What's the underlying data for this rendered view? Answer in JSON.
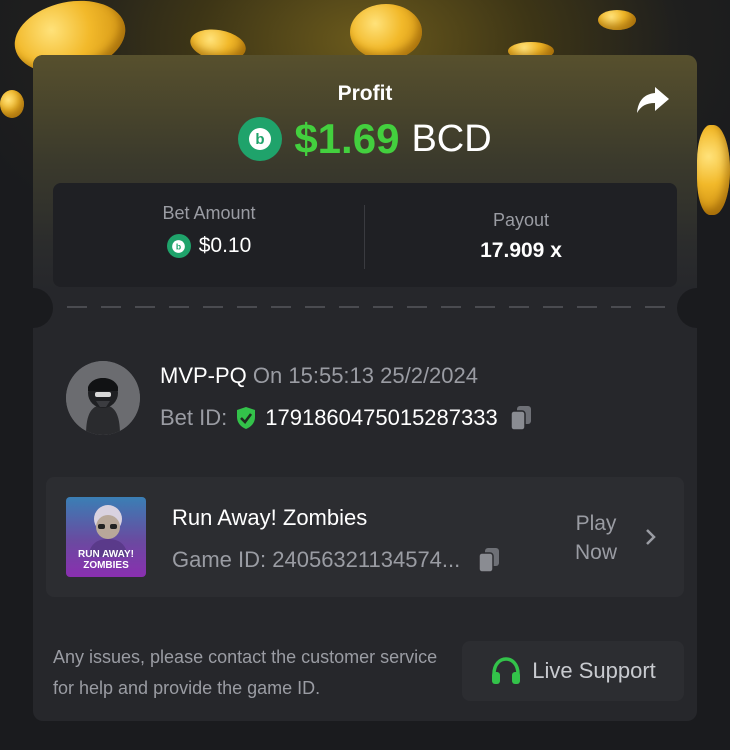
{
  "header": {
    "profit_label": "Profit",
    "profit_value": "$1.69",
    "profit_currency": "BCD",
    "share_icon": "share-arrow-icon"
  },
  "stats": {
    "bet_amount_label": "Bet Amount",
    "bet_amount_value": "$0.10",
    "payout_label": "Payout",
    "payout_value": "17.909 x"
  },
  "user": {
    "name": "MVP-PQ",
    "time": "On 15:55:13 25/2/2024",
    "bet_id_label": "Bet ID:",
    "bet_id_value": "1791860475015287333"
  },
  "game": {
    "title": "Run Away! Zombies",
    "game_id": "Game ID: 24056321134574...",
    "thumb_line1": "RUN AWAY!",
    "thumb_line2": "ZOMBIES",
    "play_now": "Play Now"
  },
  "footer": {
    "help_text": "Any issues, please contact the customer service for help and provide the game ID.",
    "support_label": "Live Support"
  },
  "colors": {
    "profit_green": "#43d03e",
    "brand_green": "#1fa36b",
    "card_bg": "#26272b",
    "page_bg": "#1a1b1e"
  }
}
